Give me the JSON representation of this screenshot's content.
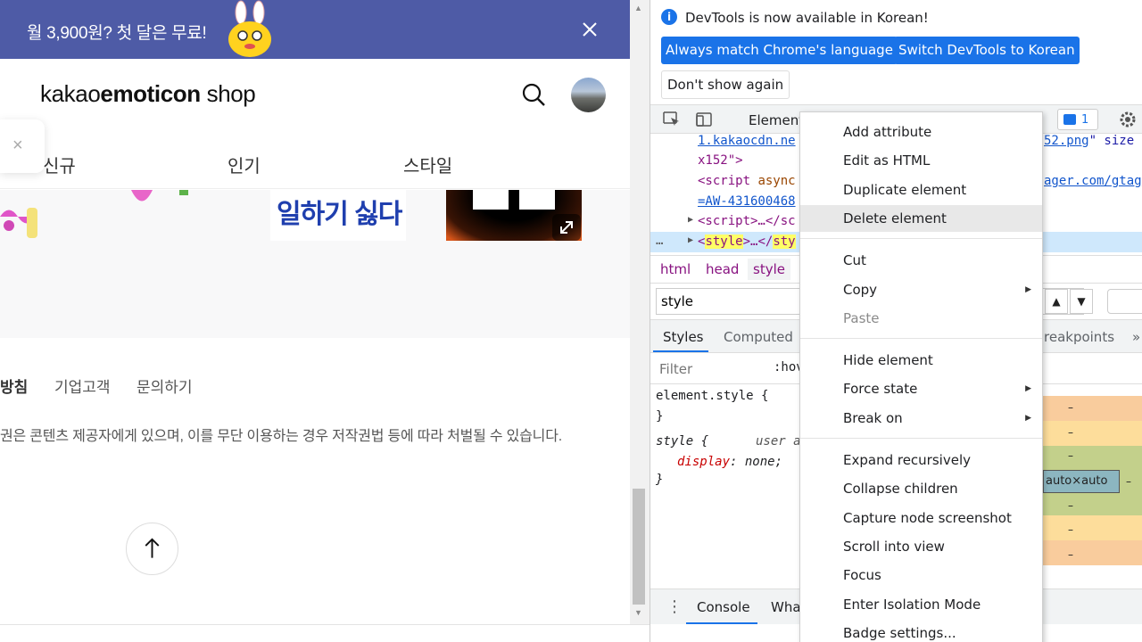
{
  "page": {
    "banner": {
      "text": "월 3,900원? 첫 달은 무료!"
    },
    "logo": {
      "part1": "kakao",
      "part2": "emoticon",
      "part3": " shop"
    },
    "tabs": [
      "신규",
      "인기",
      "스타일"
    ],
    "thumb_text": "일하기 싫다",
    "footer_links": [
      "방침",
      "기업고객",
      "문의하기"
    ],
    "copyright": "권은 콘텐츠 제공자에게 있으며, 이를 무단 이용하는 경우 저작권법 등에 따라 처벌될 수 있습니다."
  },
  "devtools": {
    "infobar": {
      "message": "DevTools is now available in Korean!",
      "btn_match": "Always match Chrome's language",
      "btn_switch": "Switch DevTools to Korean",
      "btn_dismiss": "Don't show again"
    },
    "toolbar": {
      "tab_elements": "Element",
      "issues_count": "1"
    },
    "dom": {
      "line1_link": "1.kakaocdn.ne",
      "line1_tail_link": "52.png",
      "line1_tail": "\" size",
      "line2": "x152\">",
      "line3_tag": "<script",
      "line3_attr": " async",
      "line3_tail_link": "ager.com/gtag",
      "line4_link": "=AW-431600468",
      "line5": "<script>…</sc",
      "line6_open": "<",
      "line6_tag": "style",
      "line6_mid": ">…</",
      "line6_tag2": "sty",
      "ellipsis": "…"
    },
    "breadcrumbs": [
      "html",
      "head",
      "style"
    ],
    "search": {
      "value": "style"
    },
    "styles_tabs": [
      "Styles",
      "Computed",
      "reakpoints"
    ],
    "filter": {
      "placeholder": "Filter",
      "hov": ":hov"
    },
    "rules": {
      "element_style": "element.style {",
      "close1": "}",
      "style_selector": "style {",
      "user_agent": "user a",
      "prop_name": "display",
      "prop_value": " none;",
      "close2": "}"
    },
    "boxmodel": {
      "content": "auto×auto",
      "dash": "–"
    },
    "drawer": {
      "tabs": [
        "Console",
        "Wha"
      ]
    }
  },
  "context_menu": {
    "groups": [
      [
        "Add attribute",
        "Edit as HTML",
        "Duplicate element",
        "Delete element"
      ],
      [
        "Cut",
        "Copy",
        "Paste"
      ],
      [
        "Hide element",
        "Force state",
        "Break on"
      ],
      [
        "Expand recursively",
        "Collapse children",
        "Capture node screenshot",
        "Scroll into view",
        "Focus",
        "Enter Isolation Mode",
        "Badge settings..."
      ]
    ],
    "hovered": "Delete element",
    "disabled": "Paste",
    "submenu_items": [
      "Copy",
      "Force state",
      "Break on"
    ]
  },
  "colors": {
    "banner": "#4e5ba6",
    "accent": "#1a73e8",
    "selected_row": "#cfe8fc"
  }
}
